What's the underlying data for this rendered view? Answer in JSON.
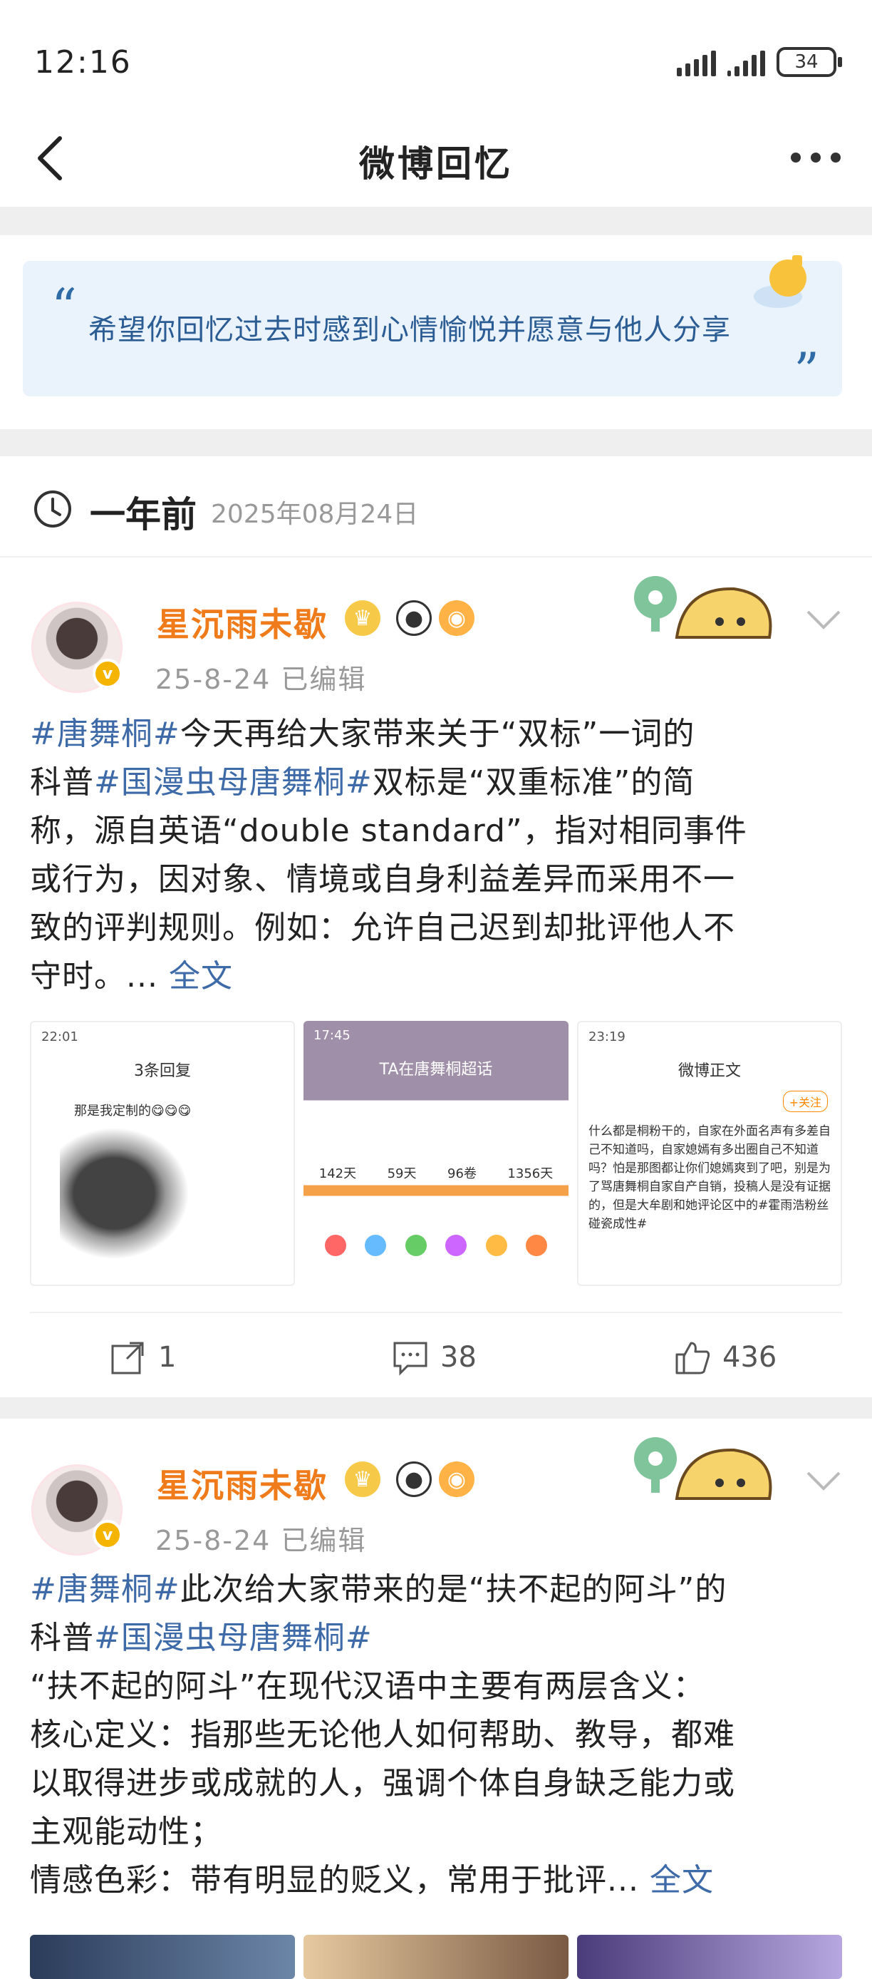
{
  "status": {
    "time": "12:16",
    "battery": "34"
  },
  "header": {
    "title": "微博回忆"
  },
  "banner": {
    "open_quote": "“",
    "text": "希望你回忆过去时感到心情愉悦并愿意与他人分享",
    "close_quote": "”"
  },
  "time_section": {
    "ago": "一年前",
    "date": "2025年08月24日"
  },
  "posts": [
    {
      "username": "星沉雨未歇",
      "verified_mark": "v",
      "meta": "25-8-24  已编辑",
      "text_lines": [
        [
          "#唐舞桐#",
          "今天再给大家带来关于“双标”一词的"
        ],
        [
          "科普",
          "#国漫虫母唐舞桐#",
          "双标是“双重标准”的简"
        ],
        [
          "称，源自英语“double standard”，指对相同事件"
        ],
        [
          "或行为，因对象、情境或自身利益差异而采用不一"
        ],
        [
          "致的评判规则。例如：允许自己迟到却批评他人不"
        ],
        [
          "守时。...",
          "全文"
        ]
      ],
      "thumbs": {
        "t1": {
          "status": "22:01",
          "title": "3条回复",
          "line": "那是我定制的😋😋😋"
        },
        "t2": {
          "status": "17:45",
          "title": "TA在唐舞桐超话",
          "stats": [
            "142天",
            "59天",
            "96卷",
            "1356天"
          ]
        },
        "t3": {
          "status": "23:19",
          "title": "微博正文",
          "follow": "+关注",
          "body": "什么都是桐粉干的，自家在外面名声有多差自己不知道吗，自家媳嫣有多出圈自己不知道吗？怕是那图都让你们媳嫣爽到了吧，别是为了骂唐舞桐自家自产自销，投稿人是没有证据的，但是大牟剧和她评论区中的#霍雨浩粉丝碰瓷成性#"
        }
      },
      "actions": {
        "repost": "1",
        "comment": "38",
        "like": "436"
      }
    },
    {
      "username": "星沉雨未歇",
      "verified_mark": "v",
      "meta": "25-8-24  已编辑",
      "text_lines": [
        [
          "#唐舞桐#",
          "此次给大家带来的是“扶不起的阿斗”的"
        ],
        [
          "科普",
          "#国漫虫母唐舞桐#"
        ],
        [
          "“扶不起的阿斗”在现代汉语中主要有两层含义："
        ],
        [
          "核心定义：指那些无论他人如何帮助、教导，都难"
        ],
        [
          "以取得进步或成就的人，强调个体自身缺乏能力或"
        ],
        [
          "主观能动性；"
        ],
        [
          "情感色彩：带有明显的贬义，常用于批评...",
          "全文"
        ]
      ]
    }
  ]
}
